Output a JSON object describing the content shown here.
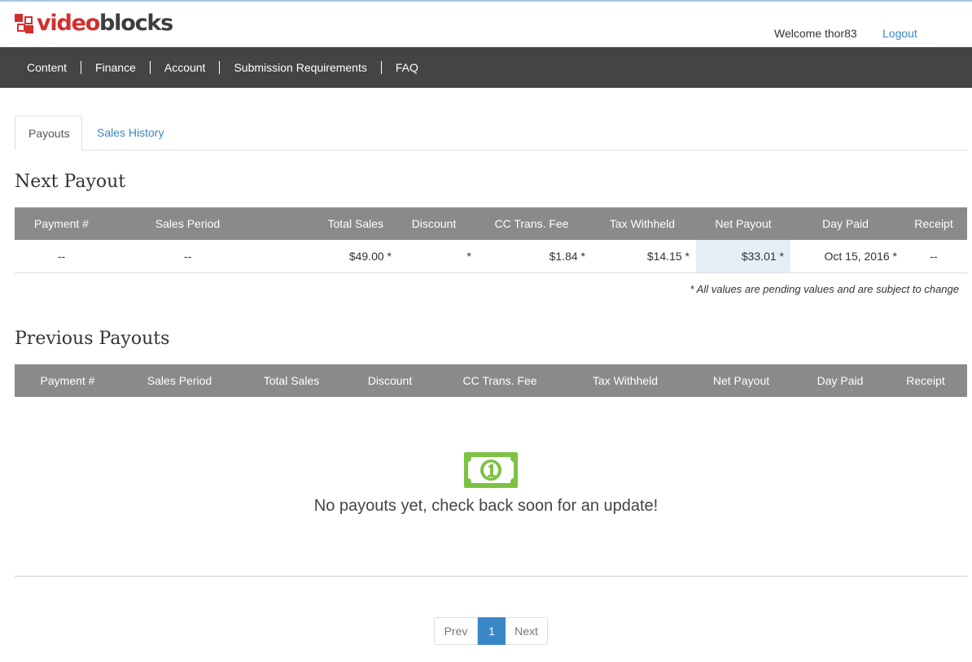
{
  "brand": {
    "logo_part1": "video",
    "logo_part2": "blocks",
    "logo_icon": "film-blocks-icon"
  },
  "header": {
    "welcome": "Welcome thor83",
    "logout": "Logout"
  },
  "nav": [
    "Content",
    "Finance",
    "Account",
    "Submission Requirements",
    "FAQ"
  ],
  "tabs": {
    "payouts": "Payouts",
    "sales_history": "Sales History"
  },
  "columns": [
    "Payment #",
    "Sales Period",
    "Total Sales",
    "Discount",
    "CC Trans. Fee",
    "Tax Withheld",
    "Net Payout",
    "Day Paid",
    "Receipt"
  ],
  "next_payout": {
    "title": "Next Payout",
    "row": {
      "payment": "--",
      "period": "--",
      "total_sales": "$49.00 *",
      "discount": "*",
      "cc_fee": "$1.84 *",
      "tax": "$14.15 *",
      "net": "$33.01 *",
      "day_paid": "Oct 15, 2016 *",
      "receipt": "--"
    },
    "note": "* All values are pending values and are subject to change"
  },
  "previous_payouts": {
    "title": "Previous Payouts",
    "empty_message": "No payouts yet, check back soon for an update!",
    "empty_icon": "dollar-bill-icon"
  },
  "pagination": {
    "prev": "Prev",
    "current": "1",
    "next": "Next"
  },
  "colors": {
    "accent": "#3a87c8",
    "brand": "#d32f2f",
    "nav_bg": "#444444",
    "table_head": "#8a8a8a",
    "highlight": "#e3eef7",
    "money_green": "#7dc242"
  }
}
